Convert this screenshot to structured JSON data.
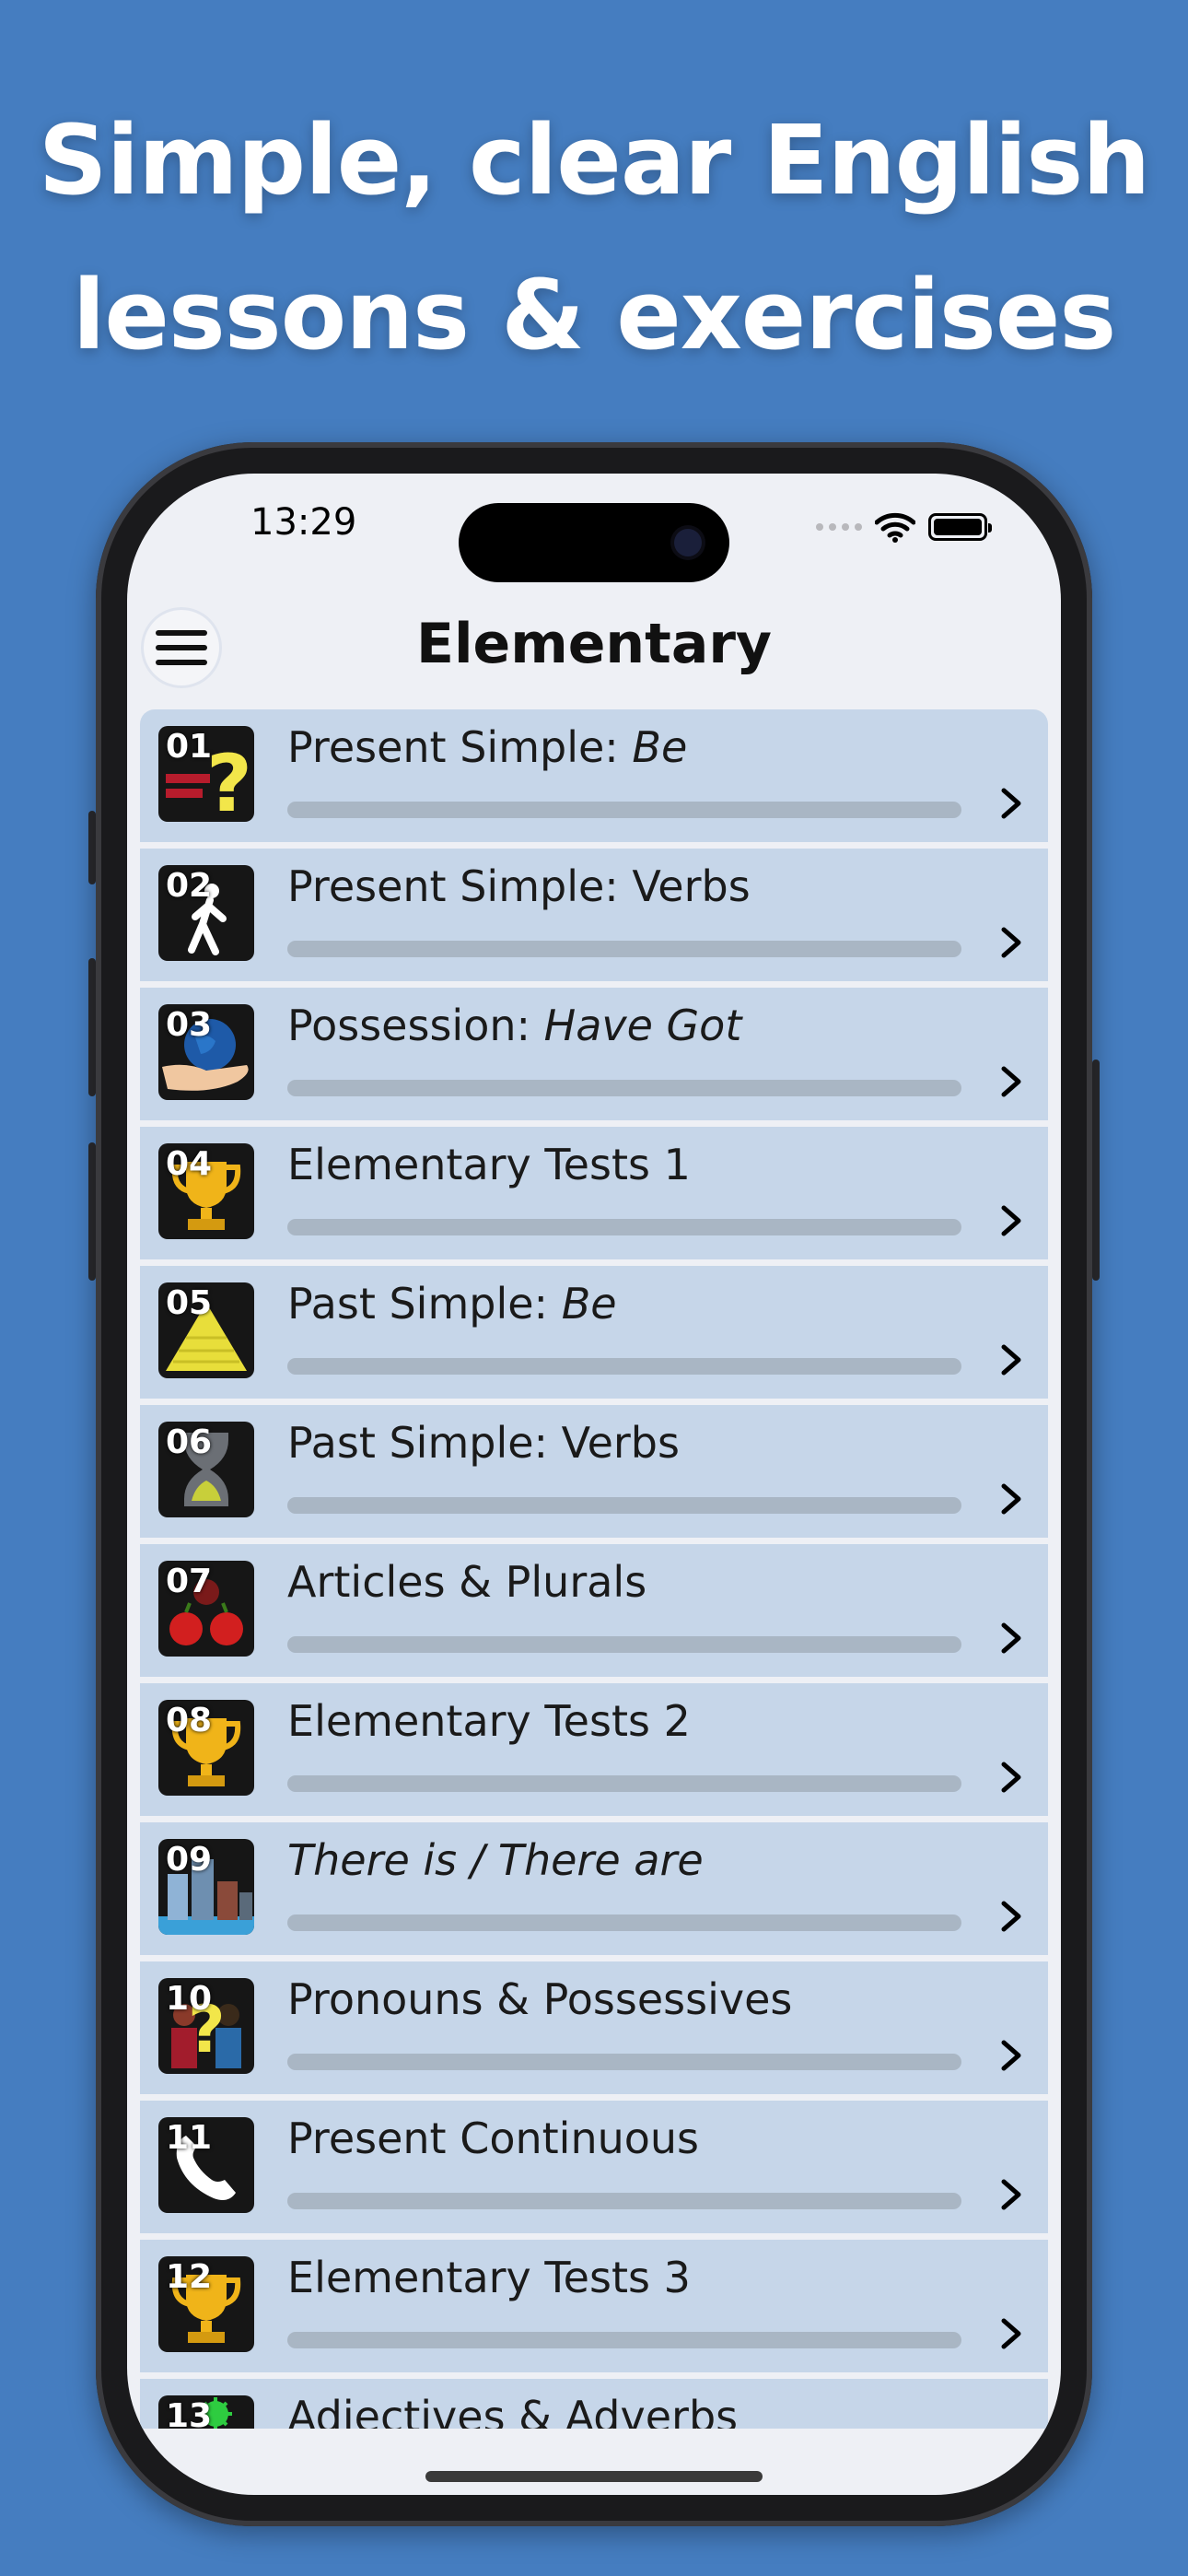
{
  "headline": {
    "line1": "Simple, clear English",
    "line2": "lessons & exercises"
  },
  "status": {
    "time": "13:29"
  },
  "nav": {
    "title": "Elementary"
  },
  "lessons": [
    {
      "num": "01",
      "title": "Present Simple: ",
      "italic": "Be",
      "progress": 0,
      "icon": "question-mark-icon"
    },
    {
      "num": "02",
      "title": "Present Simple: Verbs",
      "italic": "",
      "progress": 0,
      "icon": "walking-person-icon"
    },
    {
      "num": "03",
      "title": "Possession: ",
      "italic": "Have Got",
      "progress": 0,
      "icon": "globe-in-hand-icon"
    },
    {
      "num": "04",
      "title": "Elementary Tests 1",
      "italic": "",
      "progress": 0,
      "icon": "trophy-icon"
    },
    {
      "num": "05",
      "title": "Past Simple: ",
      "italic": "Be",
      "progress": 0,
      "icon": "pyramid-icon"
    },
    {
      "num": "06",
      "title": "Past Simple: Verbs",
      "italic": "",
      "progress": 0,
      "icon": "hourglass-icon"
    },
    {
      "num": "07",
      "title": "Articles & Plurals",
      "italic": "",
      "progress": 0,
      "icon": "apples-icon"
    },
    {
      "num": "08",
      "title": "Elementary Tests 2",
      "italic": "",
      "progress": 0,
      "icon": "trophy-icon"
    },
    {
      "num": "09",
      "title": "",
      "italic": "There is / There are",
      "progress": 0,
      "icon": "city-icon"
    },
    {
      "num": "10",
      "title": "Pronouns & Possessives",
      "italic": "",
      "progress": 0,
      "icon": "people-question-icon"
    },
    {
      "num": "11",
      "title": "Present Continuous",
      "italic": "",
      "progress": 0,
      "icon": "phone-handset-icon"
    },
    {
      "num": "12",
      "title": "Elementary Tests 3",
      "italic": "",
      "progress": 0,
      "icon": "trophy-icon"
    },
    {
      "num": "13",
      "title": "Adjectives & Adverbs",
      "italic": "",
      "progress": 0,
      "icon": "virus-icon"
    }
  ],
  "colors": {
    "background": "#457dc0",
    "row": "#c6d6e9",
    "progress_track": "#a9b6c4"
  }
}
